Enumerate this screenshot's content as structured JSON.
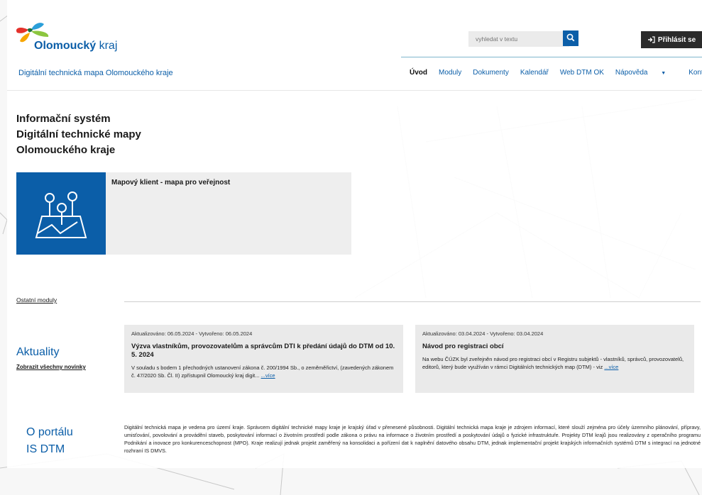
{
  "header": {
    "logo_bold": "Olomoucký",
    "logo_regular": " kraj",
    "subtitle": "Digitální technická mapa Olomouckého kraje",
    "search_placeholder": "vyhledat v textu",
    "login_label": "Přihlásit se",
    "nav": [
      "Úvod",
      "Moduly",
      "Dokumenty",
      "Kalendář",
      "Web DTM OK",
      "Nápověda",
      "Kontakty"
    ]
  },
  "intro": {
    "title_line1": "Informační systém",
    "title_line2": "Digitální technické mapy",
    "title_line3": "Olomouckého kraje",
    "tile_label": "Mapový klient - mapa pro veřejnost",
    "other_modules": "Ostatní moduly"
  },
  "news": {
    "heading": "Aktuality",
    "show_all": "Zobrazit všechny novinky",
    "cards": [
      {
        "meta": "Aktualizováno: 06.05.2024 - Vytvořeno: 06.05.2024",
        "title": "Výzva vlastníkům, provozovatelům a správcům DTI k předání údajů do DTM od 10. 5. 2024",
        "text": "V souladu s bodem 1 přechodných ustanovení zákona č. 200/1994 Sb., o zeměměřictví, (zavedených zákonem č. 47/2020 Sb. Čl. II) zpřístupnil Olomoucký kraj digit...",
        "more": "...více"
      },
      {
        "meta": "Aktualizováno: 03.04.2024 - Vytvořeno: 03.04.2024",
        "title": "Návod pro registraci obcí",
        "text": "Na webu ČÚZK byl zveřejněn návod pro registraci obcí v Registru subjektů - vlastníků, správců, provozovatelů, editorů, který bude využíván v rámci Digitálních technických map (DTM) - viz",
        "more": "...více"
      }
    ]
  },
  "about": {
    "heading_line1": "O portálu",
    "heading_line2": "IS DTM",
    "text": "Digitální technická mapa je vedena pro území kraje. Správcem digitální technické mapy kraje je krajský úřad v přenesené působnosti. Digitální technická mapa kraje je zdrojem informací, které slouží zejména pro účely územního plánování, přípravy, umisťování, povolování a provádění staveb, poskytování informací o životním prostředí podle zákona o právu na informace o životním prostředí a poskytování údajů o fyzické infrastruktuře. Projekty DTM krajů jsou realizovány z operačního programu Podnikání a inovace pro konkurenceschopnost (MPO). Kraje realizují jednak projekt zaměřený na konsolidaci a pořízení dat k naplnění datového obsahu DTM, jednak implementační projekt krajských informačních systémů DTM s integrací na jednotné rozhraní IS DMVS."
  },
  "colors": {
    "brand": "#0b5ea8",
    "dark": "#2b2b2b",
    "card": "#eaeaea"
  }
}
